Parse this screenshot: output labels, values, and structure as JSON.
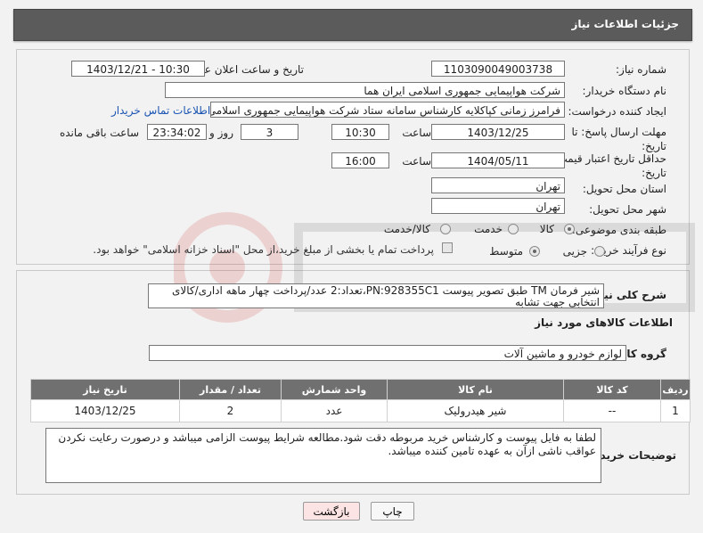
{
  "header": {
    "title": "جزئیات اطلاعات نیاز"
  },
  "form": {
    "need_number_label": "شماره نیاز:",
    "need_number": "1103090049003738",
    "announce_label": "تاریخ و ساعت اعلان عمومی:",
    "announce_value": "1403/12/21 - 10:30",
    "buyer_org_label": "نام دستگاه خریدار:",
    "buyer_org": "شرکت هواپیمایی جمهوری اسلامی ایران هما",
    "creator_label": "ایجاد کننده درخواست:",
    "creator": "فرامرز زمانی کپاکلایه کارشناس سامانه ستاد شرکت هواپیمایی جمهوری اسلامی",
    "contact_link": "اطلاعات تماس خریدار",
    "deadline_label": "مهلت ارسال پاسخ: تا تاریخ:",
    "deadline_date": "1403/12/25",
    "time_label": "ساعت",
    "deadline_time": "10:30",
    "days_value": "3",
    "days_label": "روز و",
    "remaining_time": "23:34:02",
    "remaining_label": "ساعت باقی مانده",
    "validity_label": "حداقل تاریخ اعتبار قیمت: تا تاریخ:",
    "validity_date": "1404/05/11",
    "validity_time": "16:00",
    "province_label": "استان محل تحویل:",
    "province": "تهران",
    "city_label": "شهر محل تحویل:",
    "city": "تهران",
    "category_label": "طبقه بندی موضوعی:",
    "category_options": [
      "کالا",
      "خدمت",
      "کالا/خدمت"
    ],
    "process_label": "نوع فرآیند خرید :",
    "process_options": [
      "جزیی",
      "متوسط"
    ],
    "treasury_note": "پرداخت تمام یا بخشی از مبلغ خرید،از محل \"اسناد خزانه اسلامی\" خواهد بود."
  },
  "details": {
    "summary_label": "شرح کلی نیاز:",
    "summary": "شیر فرمان TM طبق تصویر پیوست PN:928355C1،تعداد:2 عدد/پرداخت چهار ماهه اداری/کالای انتخابی جهت تشابه",
    "goods_info_title": "اطلاعات کالاهای مورد نیاز",
    "goods_group_label": "گروه کالا:",
    "goods_group": "لوازم خودرو و ماشین آلات"
  },
  "table": {
    "headers": [
      "ردیف",
      "کد کالا",
      "نام کالا",
      "واحد شمارش",
      "تعداد / مقدار",
      "تاریخ نیاز"
    ],
    "rows": [
      [
        "1",
        "--",
        "شیر هیدرولیک",
        "عدد",
        "2",
        "1403/12/25"
      ]
    ]
  },
  "buyer_notes": {
    "label": "توضیحات خریدار:",
    "text": "لطفا به فایل پیوست و کارشناس خرید مربوطه دقت شود.مطالعه شرایط پیوست الزامی میباشد و درصورت رعایت نکردن عواقب ناشی ازآن به عهده تامین کننده میباشد."
  },
  "buttons": {
    "print": "چاپ",
    "back": "بازگشت"
  },
  "colors": {
    "header_bg": "#5b5b5b",
    "link": "#1a54b3",
    "back_btn_bg": "#fde4e4"
  }
}
